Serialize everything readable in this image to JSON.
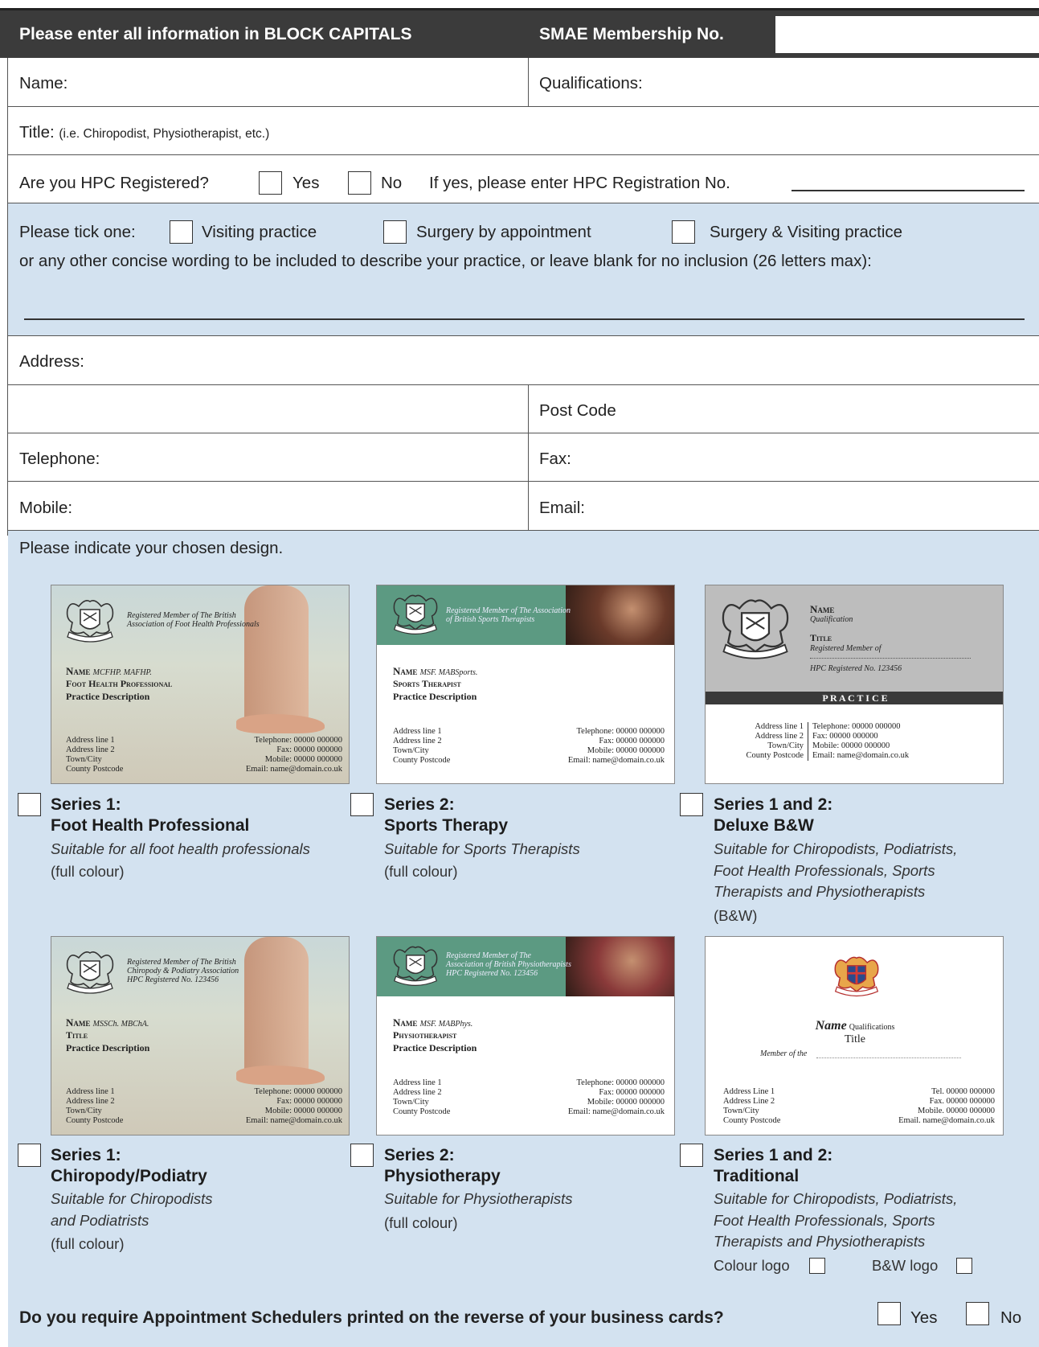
{
  "header": {
    "instruction": "Please enter all information in BLOCK CAPITALS",
    "membership_label": "SMAE Membership No."
  },
  "fields": {
    "name": "Name:",
    "qualifications": "Qualifications:",
    "title_label": "Title:",
    "title_hint": "(i.e. Chiropodist, Physiotherapist, etc.)",
    "hpc_question": "Are you HPC Registered?",
    "yes": "Yes",
    "no": "No",
    "hpc_reg": "If yes, please enter HPC Registration No.",
    "address": "Address:",
    "postcode": "Post Code",
    "telephone": "Telephone:",
    "fax": "Fax:",
    "mobile": "Mobile:",
    "email": "Email:"
  },
  "practice": {
    "tick_label": "Please tick one:",
    "options": [
      "Visiting practice",
      "Surgery by appointment",
      "Surgery & Visiting practice"
    ],
    "other_wording": "or any other concise wording to be included to describe your practice, or leave blank for no inclusion (26 letters max):"
  },
  "design": {
    "prompt": "Please indicate your chosen design.",
    "options": [
      {
        "series": "Series 1:",
        "name": "Foot Health Professional",
        "desc": [
          "Suitable for all foot health professionals"
        ],
        "note": "(full colour)"
      },
      {
        "series": "Series 2:",
        "name": "Sports Therapy",
        "desc": [
          "Suitable for Sports Therapists"
        ],
        "note": "(full colour)"
      },
      {
        "series": "Series 1 and 2:",
        "name": "Deluxe B&W",
        "desc": [
          "Suitable for Chiropodists, Podiatrists,",
          "Foot Health Professionals, Sports",
          "Therapists and Physiotherapists"
        ],
        "note": "(B&W)"
      },
      {
        "series": "Series 1:",
        "name": "Chiropody/Podiatry",
        "desc": [
          "Suitable for Chiropodists",
          "and Podiatrists"
        ],
        "note": "(full colour)"
      },
      {
        "series": "Series 2:",
        "name": "Physiotherapy",
        "desc": [
          "Suitable for Physiotherapists"
        ],
        "note": "(full colour)"
      },
      {
        "series": "Series 1 and 2:",
        "name": "Traditional",
        "desc": [
          "Suitable for Chiropodists, Podiatrists,",
          "Foot Health Professionals, Sports",
          "Therapists and Physiotherapists"
        ],
        "note": ""
      }
    ],
    "colour_logo": "Colour logo",
    "bw_logo": "B&W logo"
  },
  "cards": {
    "c1": {
      "reg": [
        "Registered Member of The British",
        "Association of Foot Health Professionals"
      ],
      "name": "Name",
      "quals": "MCFHP. MAFHP.",
      "title": "Foot Health Professional",
      "practice": "Practice Description"
    },
    "c2": {
      "reg": [
        "Registered Member of The Association",
        "of British Sports Therapists"
      ],
      "name": "Name",
      "quals": "MSF. MABSports.",
      "title": "Sports Therapist",
      "practice": "Practice Description"
    },
    "c3": {
      "name": "Name",
      "qual": "Qualification",
      "title": "Title",
      "reg": "Registered Member of",
      "hpc": "HPC Registered No. 123456",
      "practice": "P R A C T I C E",
      "left": [
        "Address line 1",
        "Address line 2",
        "Town/City",
        "County  Postcode"
      ],
      "right": [
        "Telephone: 00000 000000",
        "Fax: 00000 000000",
        "Mobile: 00000 000000",
        "Email: name@domain.co.uk"
      ]
    },
    "c4": {
      "reg": [
        "Registered Member of The British",
        "Chiropody & Podiatry Association",
        "HPC Registered No. 123456"
      ],
      "name": "Name",
      "quals": "MSSCh. MBChA.",
      "title": "Title",
      "practice": "Practice Description"
    },
    "c5": {
      "reg": [
        "Registered Member of The",
        "Association of British Physiotherapists",
        "HPC Registered No. 123456"
      ],
      "name": "Name",
      "quals": "MSF. MABPhys.",
      "title": "Physiotherapist",
      "practice": "Practice Description"
    },
    "c6": {
      "name": "Name",
      "quals": "Qualifications",
      "title": "Title",
      "member": "Member of the",
      "left": [
        "Address Line 1",
        "Address Line 2",
        "Town/City",
        "County Postcode"
      ],
      "right": [
        "Tel. 00000 000000",
        "Fax. 00000 000000",
        "Mobile. 00000 000000",
        "Email. name@domain.co.uk"
      ]
    },
    "contact_left": [
      "Address line 1",
      "Address line 2",
      "Town/City",
      "County  Postcode"
    ],
    "contact_right": [
      "Telephone: 00000 000000",
      "Fax: 00000 000000",
      "Mobile: 00000 000000",
      "Email: name@domain.co.uk"
    ]
  },
  "footer": {
    "question": "Do you require Appointment Schedulers printed on the reverse of your business cards?",
    "yes": "Yes",
    "no": "No"
  },
  "colors": {
    "header_bg": "#3b3b3b",
    "panel_bg": "#d3e2f0",
    "card_green": "#5c9a82"
  }
}
